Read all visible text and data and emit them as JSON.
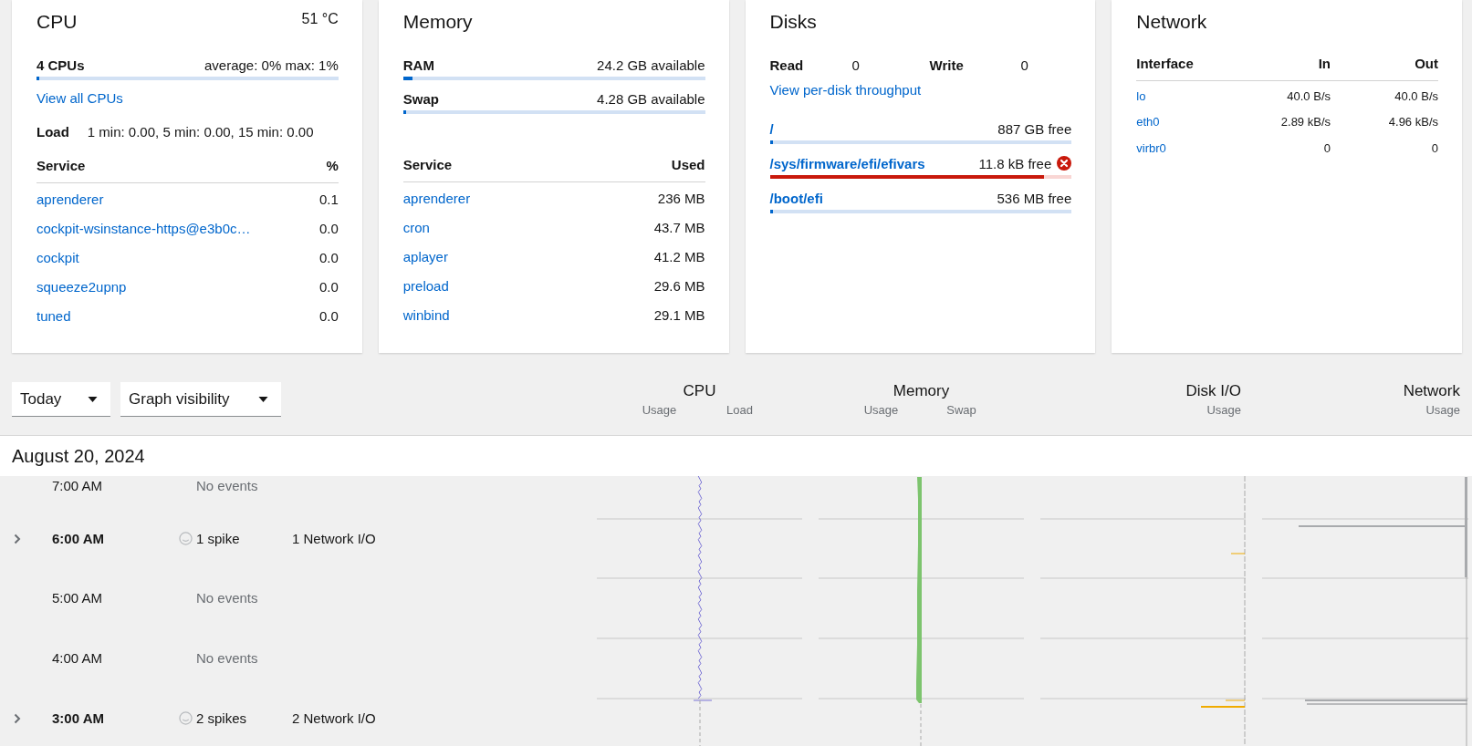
{
  "cpu_card": {
    "title": "CPU",
    "temperature": "51 °C",
    "meter": {
      "label": "4 CPUs",
      "reading": "average: 0% max: 1%",
      "level": 0.005
    },
    "link": "View all CPUs",
    "load": {
      "label": "Load",
      "value": "1 min: 0.00, 5 min: 0.00, 15 min: 0.00"
    },
    "columns": [
      "Service",
      "%"
    ],
    "services": [
      {
        "name": "aprenderer",
        "value": "0.1"
      },
      {
        "name": "cockpit-wsinstance-https@e3b0c…",
        "value": "0.0"
      },
      {
        "name": "cockpit",
        "value": "0.0"
      },
      {
        "name": "squeeze2upnp",
        "value": "0.0"
      },
      {
        "name": "tuned",
        "value": "0.0"
      }
    ]
  },
  "memory_card": {
    "title": "Memory",
    "meters": [
      {
        "label": "RAM",
        "reading": "24.2 GB available",
        "level": 0.03
      },
      {
        "label": "Swap",
        "reading": "4.28 GB available",
        "level": 0
      }
    ],
    "columns": [
      "Service",
      "Used"
    ],
    "services": [
      {
        "name": "aprenderer",
        "value": "236 MB"
      },
      {
        "name": "cron",
        "value": "43.7 MB"
      },
      {
        "name": "aplayer",
        "value": "41.2 MB"
      },
      {
        "name": "preload",
        "value": "29.6 MB"
      },
      {
        "name": "winbind",
        "value": "29.1 MB"
      }
    ]
  },
  "disks_card": {
    "title": "Disks",
    "stats": [
      {
        "label": "Read",
        "value": "0"
      },
      {
        "label": "Write",
        "value": "0"
      }
    ],
    "link": "View per-disk throughput",
    "mounts": [
      {
        "path": "/",
        "reading": "887 GB free",
        "level": 0.006,
        "error": false
      },
      {
        "path": "/sys/firmware/efi/efivars",
        "reading": "11.8 kB free",
        "level": 0.91,
        "error": true
      },
      {
        "path": "/boot/efi",
        "reading": "536 MB free",
        "level": 0.01,
        "error": false
      }
    ]
  },
  "network_card": {
    "title": "Network",
    "columns": [
      "Interface",
      "In",
      "Out"
    ],
    "rows": [
      {
        "name": "lo",
        "in": "40.0 B/s",
        "out": "40.0 B/s"
      },
      {
        "name": "eth0",
        "in": "2.89 kB/s",
        "out": "4.96 kB/s"
      },
      {
        "name": "virbr0",
        "in": "0",
        "out": "0"
      }
    ]
  },
  "toolbar": {
    "range": "Today",
    "visibility": "Graph visibility"
  },
  "graph_headers": [
    {
      "title": "CPU",
      "labels": [
        "Usage",
        "Load"
      ]
    },
    {
      "title": "Memory",
      "labels": [
        "Usage",
        "Swap"
      ]
    },
    {
      "title": "Disk I/O",
      "labels": [
        "Usage"
      ]
    },
    {
      "title": "Network",
      "labels": [
        "Usage"
      ]
    }
  ],
  "date": "August 20, 2024",
  "hours": [
    {
      "time": "7:00 AM",
      "expandable": false,
      "status": "No events"
    },
    {
      "time": "6:00 AM",
      "expandable": true,
      "status": "1 spike",
      "detail": "1 Network I/O"
    },
    {
      "time": "5:00 AM",
      "expandable": false,
      "status": "No events"
    },
    {
      "time": "4:00 AM",
      "expandable": false,
      "status": "No events"
    },
    {
      "time": "3:00 AM",
      "expandable": true,
      "status": "2 spikes",
      "detail": "2 Network I/O"
    }
  ]
}
